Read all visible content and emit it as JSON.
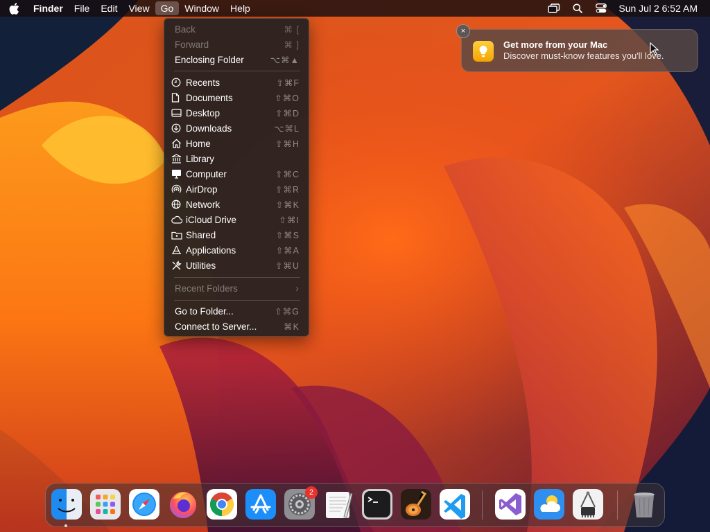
{
  "menubar": {
    "app_name": "Finder",
    "menus": [
      "File",
      "Edit",
      "View",
      "Go",
      "Window",
      "Help"
    ],
    "active_menu": "Go",
    "datetime": "Sun Jul 2  6:52 AM"
  },
  "go_menu": {
    "items": [
      {
        "label": "Back",
        "shortcut": "⌘ [",
        "disabled": true,
        "icon": null
      },
      {
        "label": "Forward",
        "shortcut": "⌘ ]",
        "disabled": true,
        "icon": null
      },
      {
        "label": "Enclosing Folder",
        "shortcut": "⌥⌘▲",
        "disabled": false,
        "icon": null
      },
      {
        "label": "Recents",
        "shortcut": "⇧⌘F",
        "icon": "clock-icon"
      },
      {
        "label": "Documents",
        "shortcut": "⇧⌘O",
        "icon": "document-icon"
      },
      {
        "label": "Desktop",
        "shortcut": "⇧⌘D",
        "icon": "desktop-icon"
      },
      {
        "label": "Downloads",
        "shortcut": "⌥⌘L",
        "icon": "download-icon"
      },
      {
        "label": "Home",
        "shortcut": "⇧⌘H",
        "icon": "home-icon"
      },
      {
        "label": "Library",
        "shortcut": "",
        "icon": "library-icon"
      },
      {
        "label": "Computer",
        "shortcut": "⇧⌘C",
        "icon": "computer-icon"
      },
      {
        "label": "AirDrop",
        "shortcut": "⇧⌘R",
        "icon": "airdrop-icon"
      },
      {
        "label": "Network",
        "shortcut": "⇧⌘K",
        "icon": "network-icon"
      },
      {
        "label": "iCloud Drive",
        "shortcut": "⇧⌘I",
        "icon": "cloud-icon"
      },
      {
        "label": "Shared",
        "shortcut": "⇧⌘S",
        "icon": "shared-folder-icon"
      },
      {
        "label": "Applications",
        "shortcut": "⇧⌘A",
        "icon": "applications-icon"
      },
      {
        "label": "Utilities",
        "shortcut": "⇧⌘U",
        "icon": "utilities-icon"
      },
      {
        "label": "Recent Folders",
        "shortcut": "›",
        "disabled": true,
        "icon": null
      },
      {
        "label": "Go to Folder...",
        "shortcut": "⇧⌘G",
        "icon": null
      },
      {
        "label": "Connect to Server...",
        "shortcut": "⌘K",
        "icon": null
      }
    ]
  },
  "notification": {
    "title": "Get more from your Mac",
    "body": "Discover must-know features you'll love.",
    "close": "×"
  },
  "dock": {
    "apps": [
      "finder-icon",
      "launchpad-icon",
      "safari-icon",
      "firefox-icon",
      "chrome-icon",
      "app-store-icon",
      "system-settings-icon",
      "textedit-icon",
      "terminal-icon",
      "garageband-icon",
      "vscode-icon",
      "visual-studio-icon",
      "weather-icon",
      "system-information-icon",
      "trash-icon"
    ],
    "settings_badge": "2"
  },
  "colors": {
    "menu_bg": "#242020",
    "badge": "#e8322b",
    "notif_icon": "#f5b400"
  }
}
